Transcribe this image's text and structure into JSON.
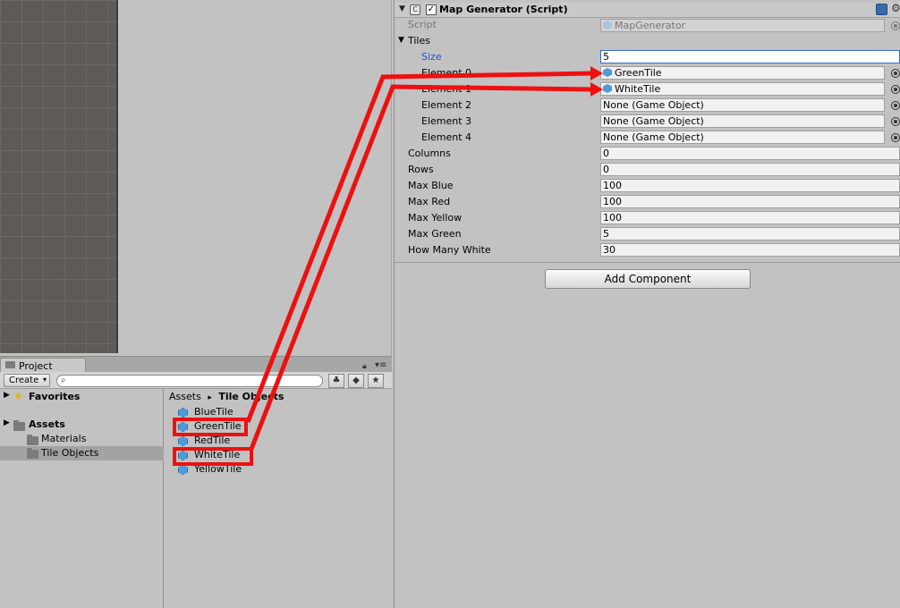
{
  "project_panel": {
    "tab_label": "Project",
    "create_label": "Create",
    "search_placeholder": "",
    "favorites_label": "Favorites",
    "assets_label": "Assets",
    "tree": [
      "Materials",
      "Tile Objects"
    ],
    "selected_folder": "Tile Objects",
    "breadcrumb": {
      "root": "Assets",
      "separator": "▸",
      "current": "Tile Objects"
    },
    "files": [
      "BlueTile",
      "GreenTile",
      "RedTile",
      "WhiteTile",
      "YellowTile"
    ],
    "highlighted_files": [
      "GreenTile",
      "WhiteTile"
    ]
  },
  "inspector": {
    "component_title": "Map Generator (Script)",
    "component_enabled": true,
    "script_label": "Script",
    "script_value": "MapGenerator",
    "tiles_label": "Tiles",
    "size_label": "Size",
    "size_value": "5",
    "elements": [
      {
        "label": "Element 0",
        "value": "GreenTile",
        "has_icon": true
      },
      {
        "label": "Element 1",
        "value": "WhiteTile",
        "has_icon": true
      },
      {
        "label": "Element 2",
        "value": "None (Game Object)",
        "has_icon": false
      },
      {
        "label": "Element 3",
        "value": "None (Game Object)",
        "has_icon": false
      },
      {
        "label": "Element 4",
        "value": "None (Game Object)",
        "has_icon": false
      }
    ],
    "fields": [
      {
        "label": "Columns",
        "value": "0"
      },
      {
        "label": "Rows",
        "value": "0"
      },
      {
        "label": "Max Blue",
        "value": "100"
      },
      {
        "label": "Max Red",
        "value": "100"
      },
      {
        "label": "Max Yellow",
        "value": "100"
      },
      {
        "label": "Max Green",
        "value": "5"
      },
      {
        "label": "How Many White",
        "value": "30"
      }
    ],
    "add_component_label": "Add Component"
  },
  "colors": {
    "annotation": "#ee1010",
    "size_label": "#1f4fd6",
    "selected_row": "#a3a3a3"
  },
  "icons": [
    "folder-icon",
    "star-icon",
    "cube-icon",
    "lock-icon",
    "menu-icon",
    "search-icon",
    "gear-icon",
    "help-icon",
    "object-picker-icon"
  ]
}
